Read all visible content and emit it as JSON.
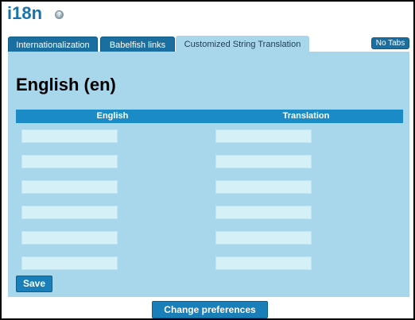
{
  "header": {
    "title": "i18n",
    "help_icon": "help-icon"
  },
  "tabs": [
    {
      "label": "Internationalization",
      "active": false
    },
    {
      "label": "Babelfish links",
      "active": false
    },
    {
      "label": "Customized String Translation",
      "active": true
    }
  ],
  "no_tabs_label": "No Tabs",
  "panel": {
    "language_heading": "English (en)",
    "columns": [
      "English",
      "Translation"
    ],
    "rows": [
      {
        "english": "",
        "translation": ""
      },
      {
        "english": "",
        "translation": ""
      },
      {
        "english": "",
        "translation": ""
      },
      {
        "english": "",
        "translation": ""
      },
      {
        "english": "",
        "translation": ""
      },
      {
        "english": "",
        "translation": ""
      }
    ],
    "save_label": "Save"
  },
  "footer": {
    "change_preferences_label": "Change preferences"
  },
  "colors": {
    "accent": "#1a6ea0",
    "panel_bg": "#a8d6eb",
    "input_bg": "#d6f0f8",
    "header_bg": "#1a8bc6"
  }
}
